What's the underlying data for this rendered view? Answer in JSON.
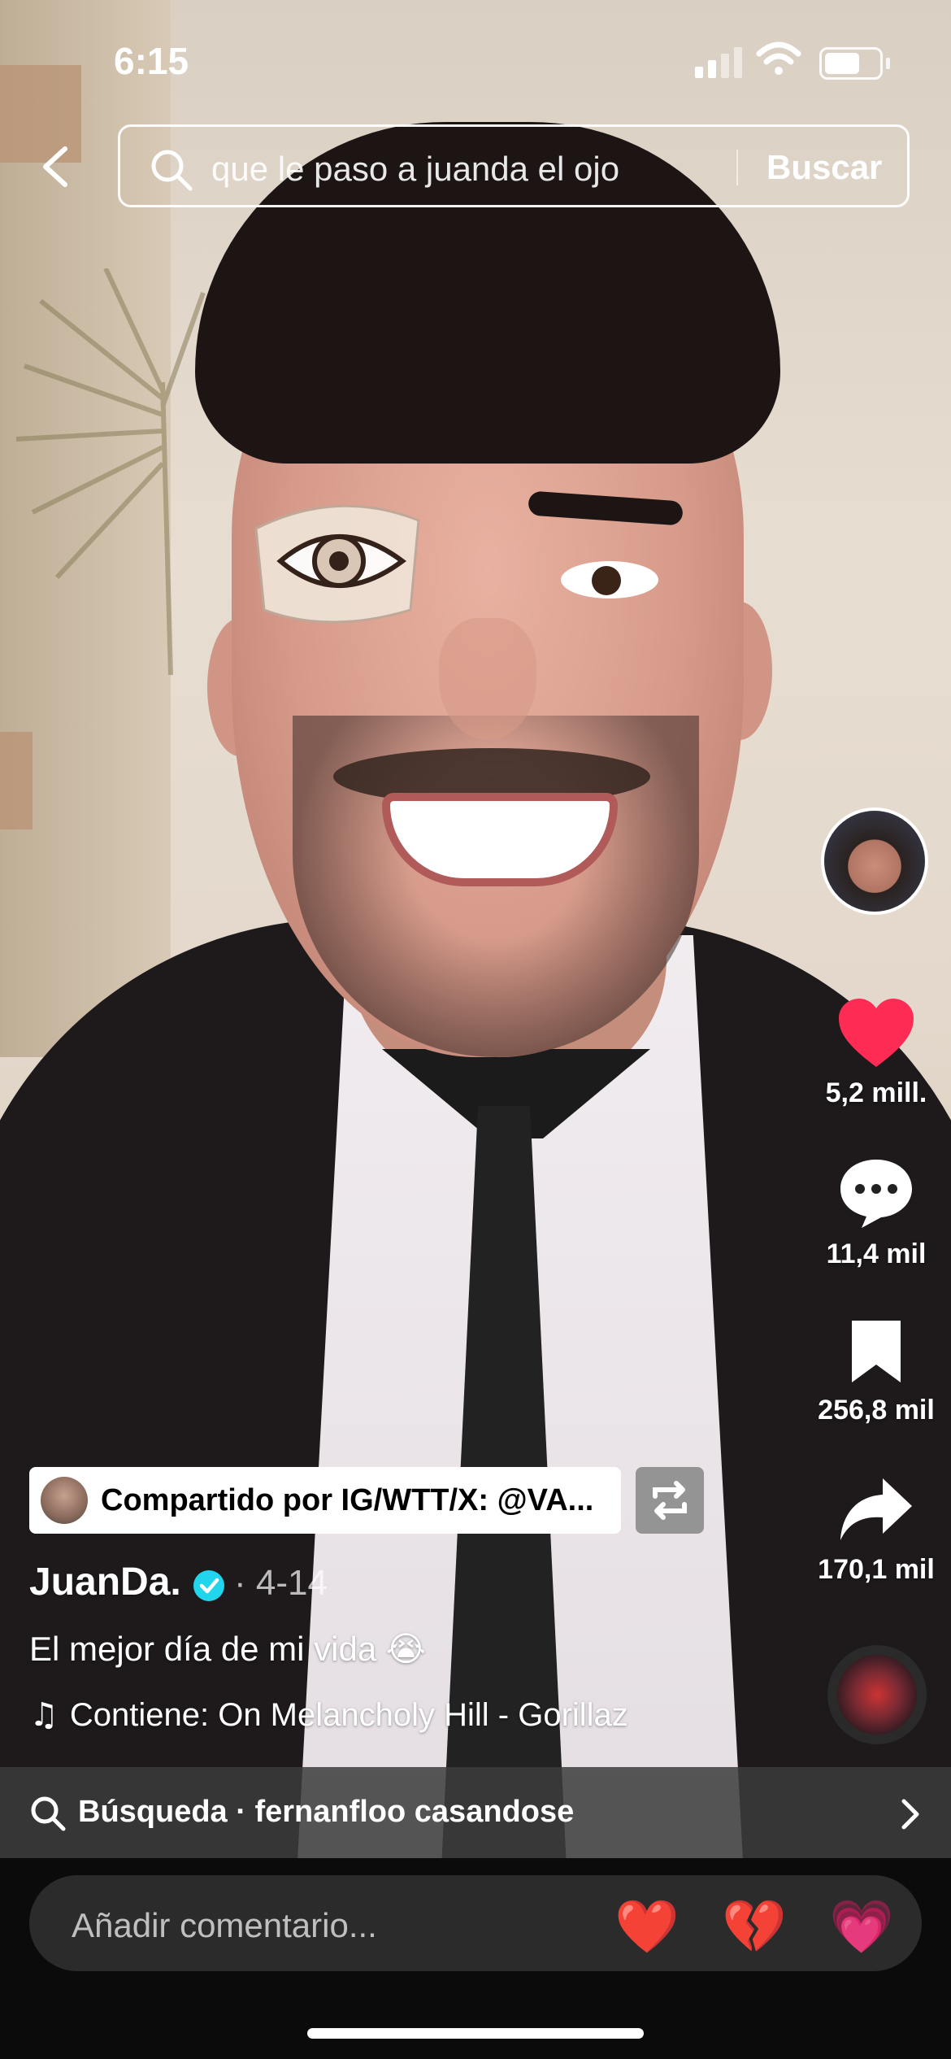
{
  "status_bar": {
    "time": "6:15"
  },
  "header": {
    "search_query": "que le paso a juanda el ojo",
    "search_button": "Buscar"
  },
  "rail": {
    "likes": "5,2 mill.",
    "comments": "11,4 mil",
    "saves": "256,8 mil",
    "shares": "170,1 mil",
    "like_color": "#fe2c55"
  },
  "post": {
    "shared_by": "Compartido por IG/WTT/X: @VA...",
    "username": "JuanDa.",
    "date": "· 4-14",
    "caption": "El mejor día de mi vida",
    "caption_emoji": "😭",
    "music": "Contiene: On Melancholy Hill - Gorillaz"
  },
  "suggestion": {
    "text": "Búsqueda · fernanfloo casandose"
  },
  "comment_bar": {
    "placeholder": "Añadir comentario...",
    "reactions": [
      "❤️",
      "💔",
      "💗"
    ]
  }
}
